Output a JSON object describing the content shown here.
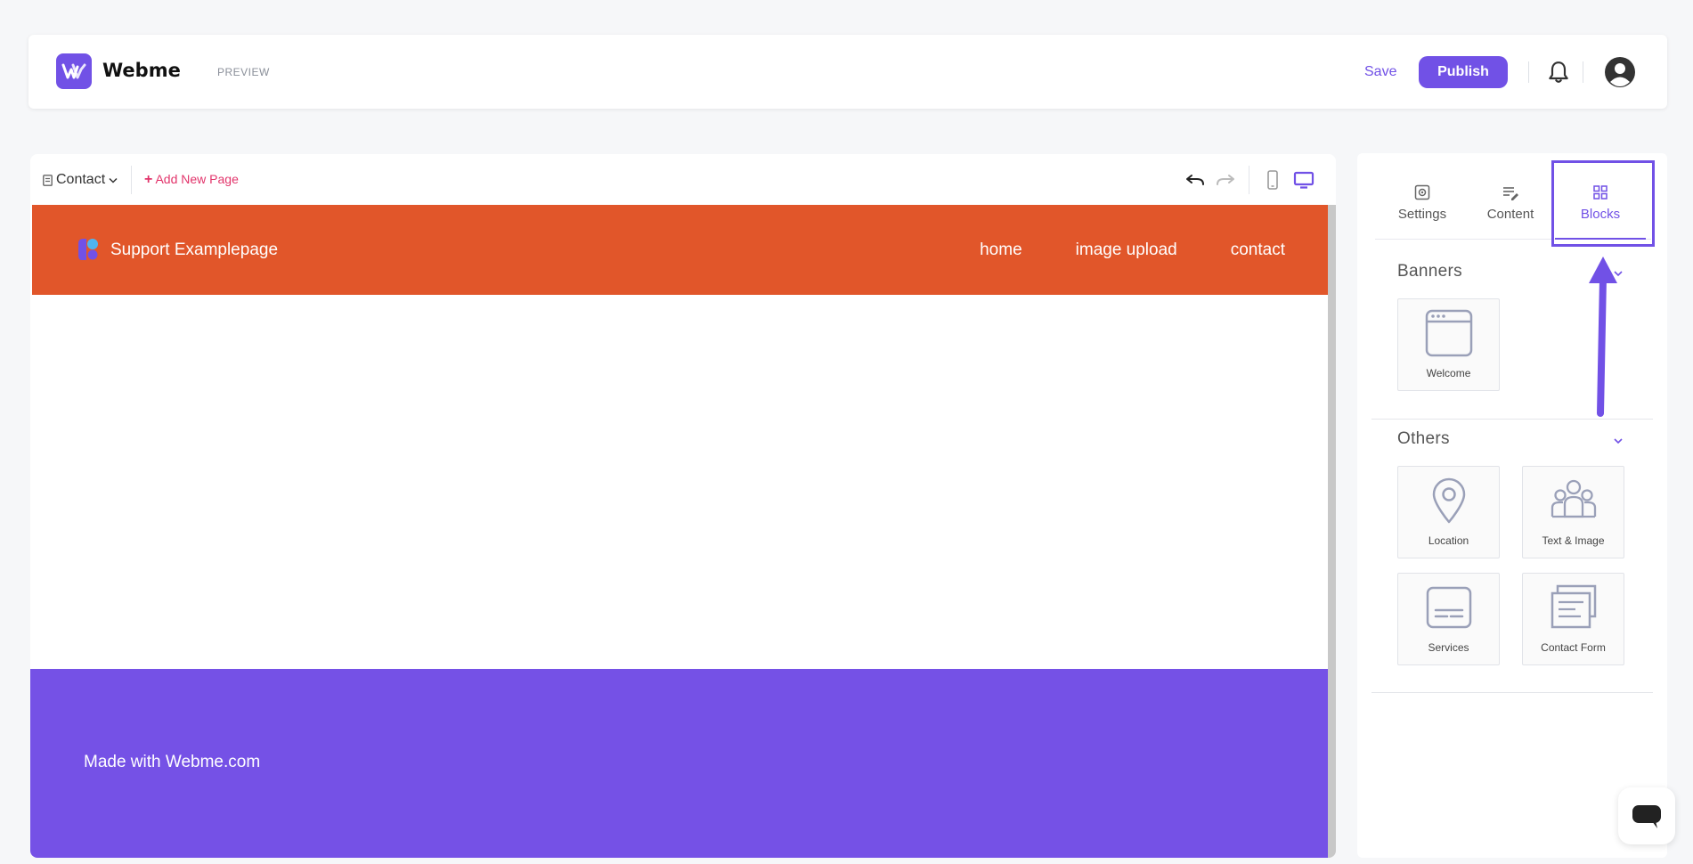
{
  "topbar": {
    "brand": "Webme",
    "mode_label": "PREVIEW",
    "save_label": "Save",
    "publish_label": "Publish",
    "icons": {
      "logo": "webme-logo-icon",
      "notifications": "bell-icon",
      "profile": "user-circle-icon"
    }
  },
  "editor": {
    "current_page": "Contact",
    "add_page_label": "Add New Page",
    "add_page_plus": "+",
    "tools": [
      "undo-icon",
      "redo-icon",
      "mobile-view-icon",
      "desktop-view-icon"
    ]
  },
  "site": {
    "name": "Support Examplepage",
    "nav": [
      "home",
      "image upload",
      "contact"
    ],
    "footer_text": "Made with Webme.com",
    "header_color": "#e1562a",
    "footer_color": "#7551e6"
  },
  "sidebar": {
    "tabs": [
      {
        "label": "Settings",
        "icon": "gear-icon"
      },
      {
        "label": "Content",
        "icon": "edit-list-icon"
      },
      {
        "label": "Blocks",
        "icon": "grid-icon"
      }
    ],
    "active_tab": "Blocks",
    "sections": {
      "banners": {
        "title": "Banners",
        "blocks": [
          "Welcome"
        ]
      },
      "others": {
        "title": "Others",
        "blocks": [
          "Location",
          "Text & Image",
          "Services",
          "Contact Form"
        ]
      }
    }
  },
  "colors": {
    "accent": "#7151e6",
    "add_page": "#e2346b"
  }
}
